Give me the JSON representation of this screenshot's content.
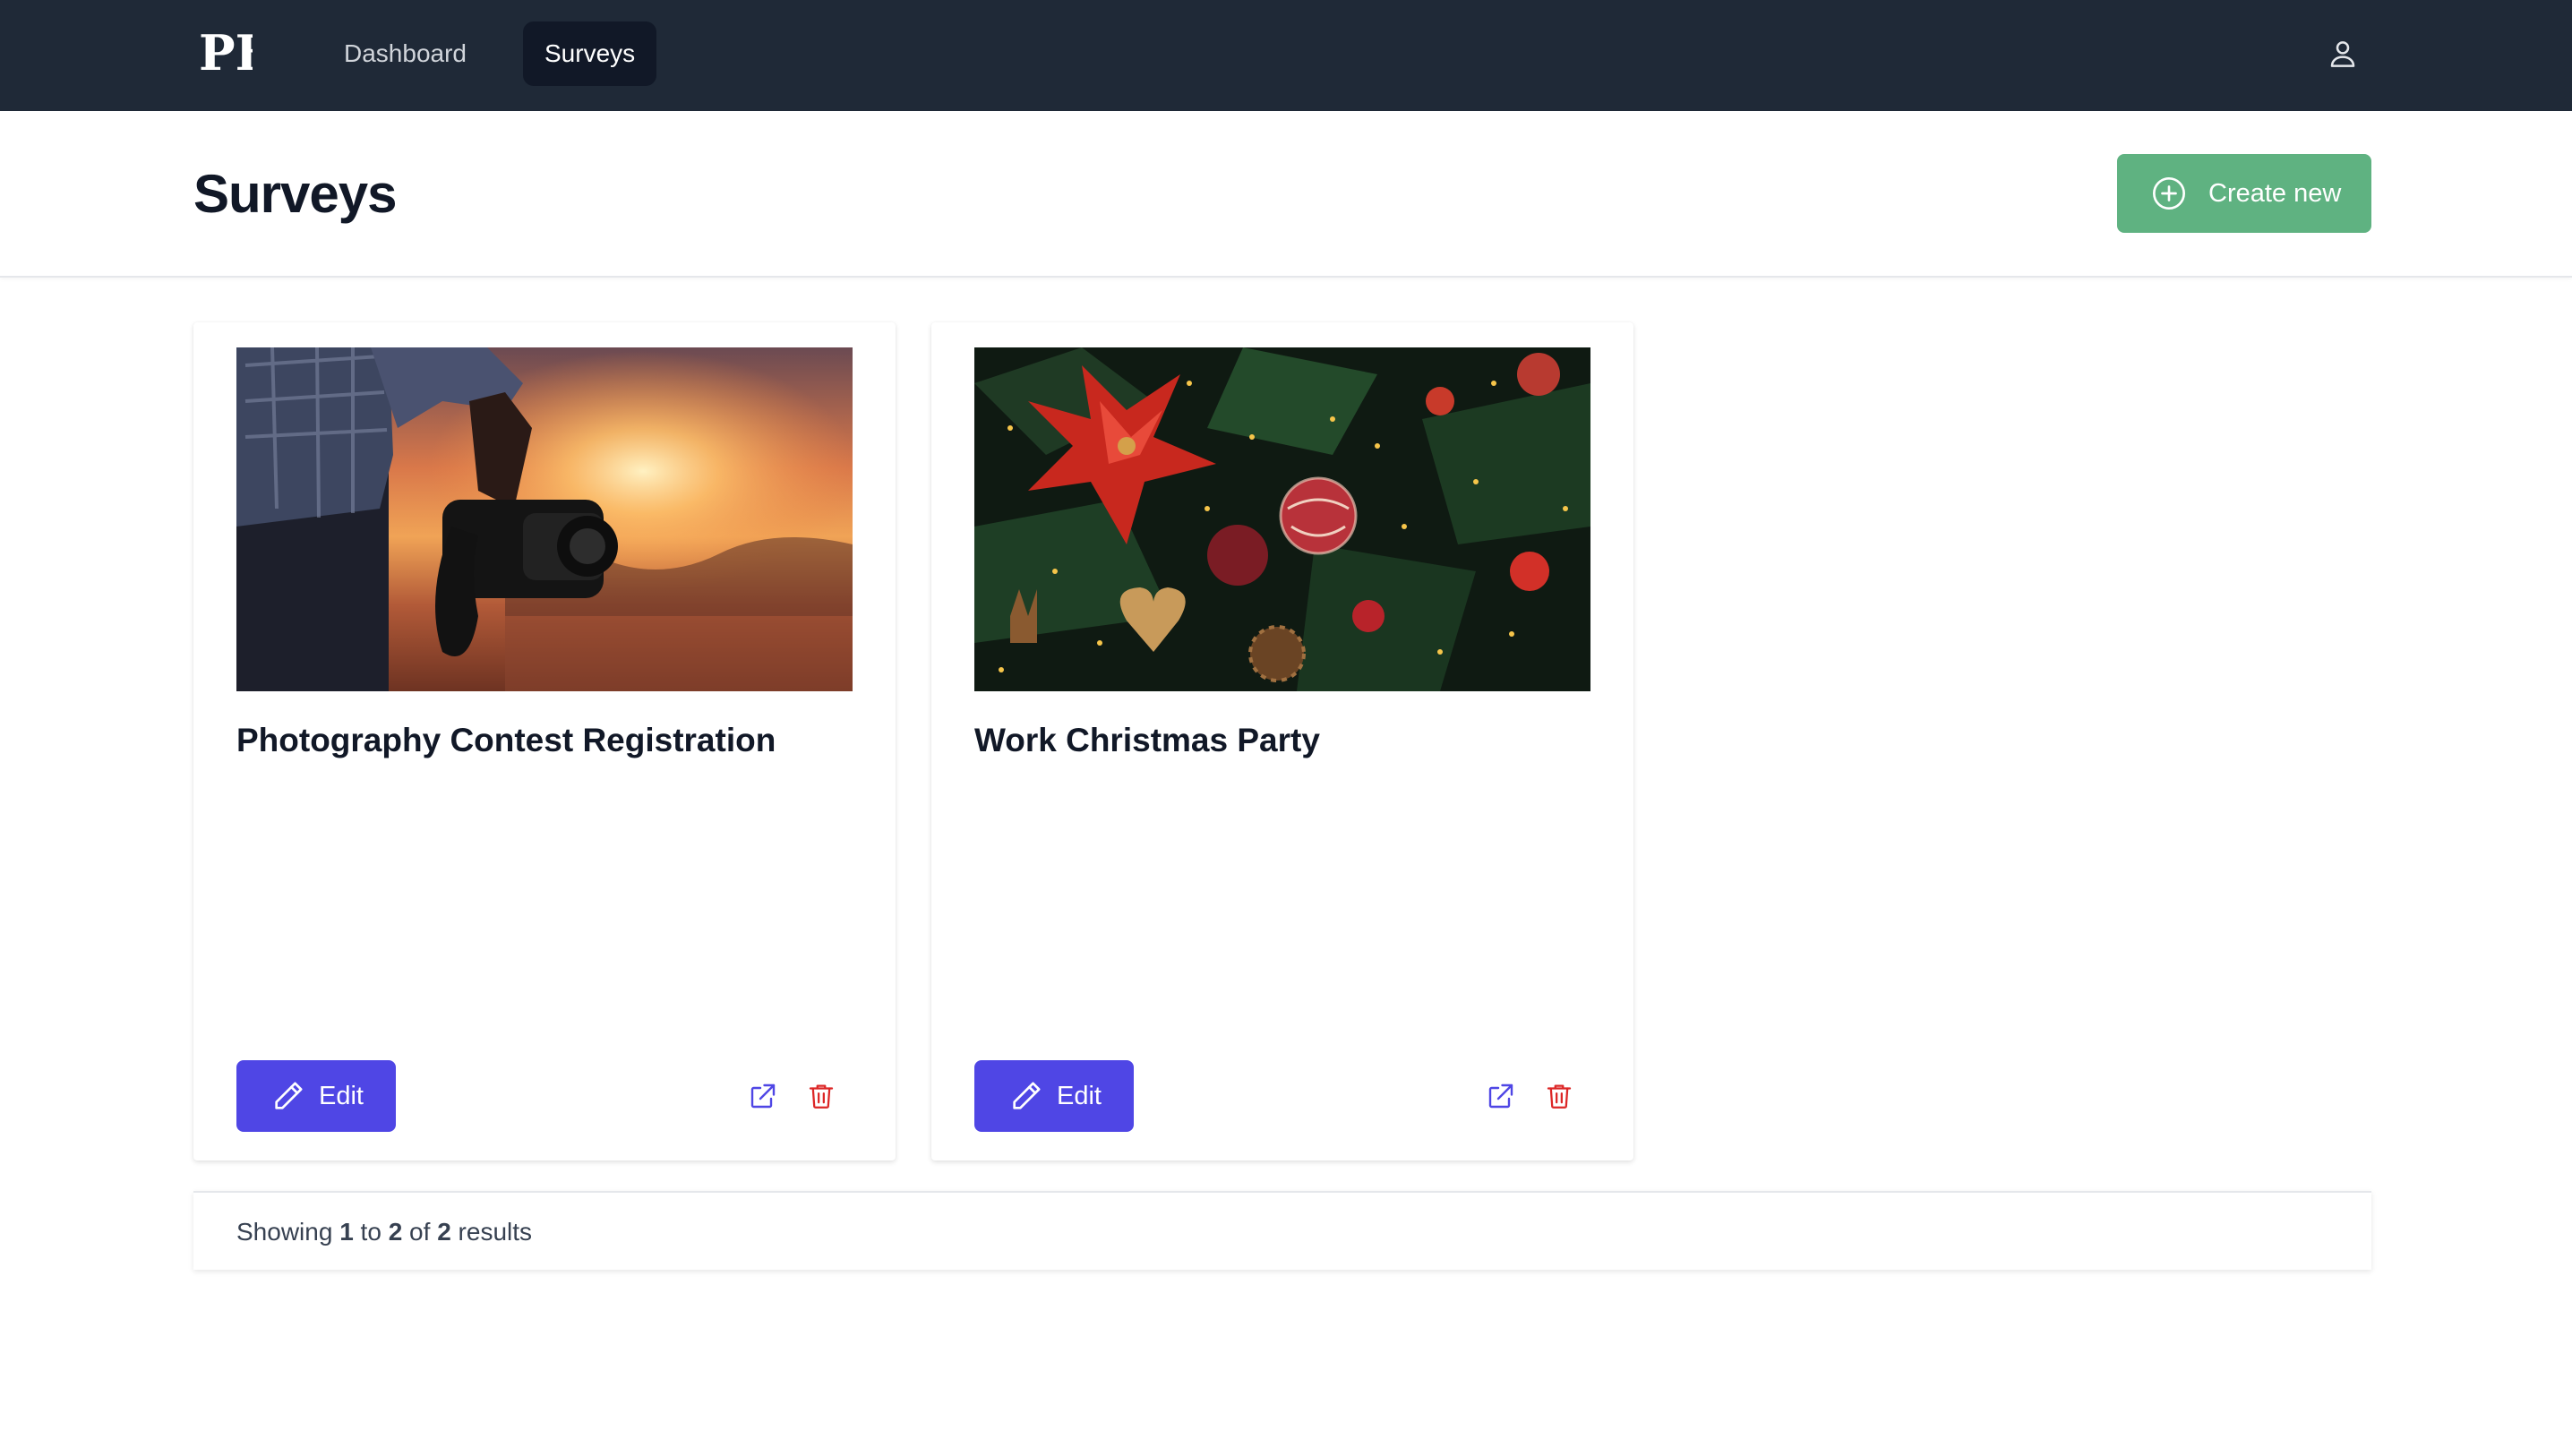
{
  "nav": {
    "logo_text": "PF",
    "items": [
      {
        "label": "Dashboard"
      },
      {
        "label": "Surveys"
      }
    ],
    "user_icon": "user-icon"
  },
  "header": {
    "title": "Surveys",
    "create_button": {
      "label": "Create new",
      "icon": "plus-circle-icon"
    }
  },
  "surveys": [
    {
      "title": "Photography Contest Registration",
      "edit_label": "Edit",
      "image": "photographer-holding-camera-at-sunset"
    },
    {
      "title": "Work Christmas Party",
      "edit_label": "Edit",
      "image": "christmas-tree-ornaments"
    }
  ],
  "pagination": {
    "prefix": "Showing",
    "from": "1",
    "to_word": "to",
    "to": "2",
    "of_word": "of",
    "total": "2",
    "suffix": "results"
  },
  "colors": {
    "nav_bg": "#1f2937",
    "active_nav_bg": "#111827",
    "create_button": "#5fb281",
    "edit_button": "#4f46e5",
    "open_icon": "#4f46e5",
    "delete_icon": "#dc2626"
  }
}
